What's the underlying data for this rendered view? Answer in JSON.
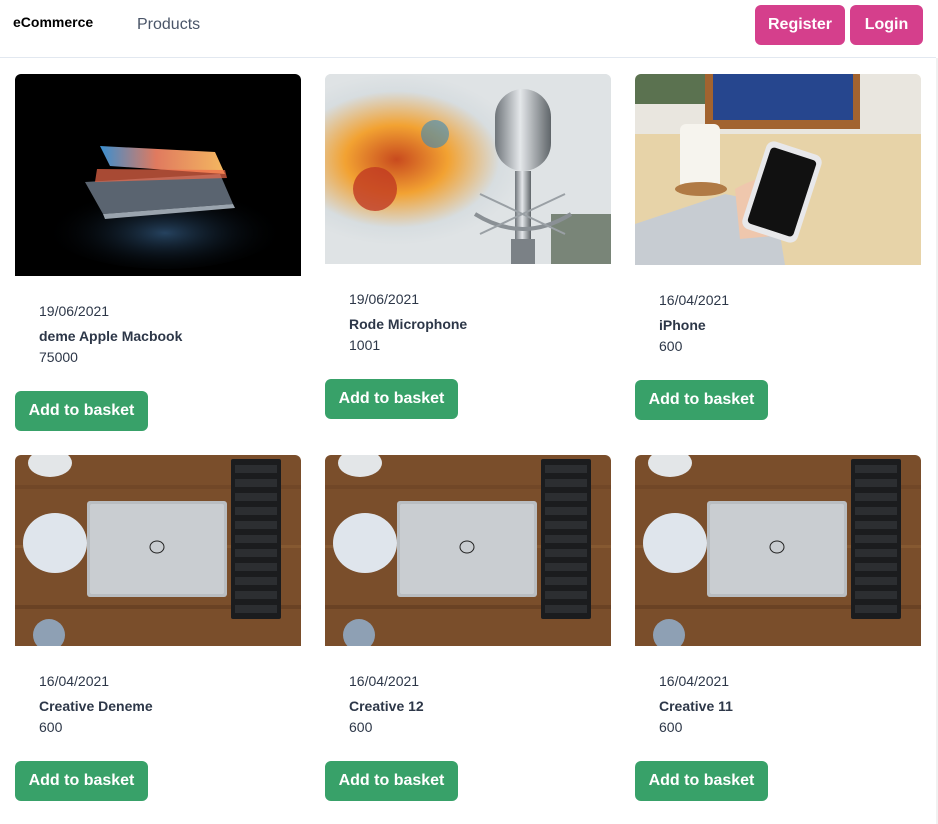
{
  "nav": {
    "brand": "eCommerce",
    "products_link": "Products",
    "register_label": "Register",
    "login_label": "Login"
  },
  "colors": {
    "register_button": "#d53f8c",
    "add_button": "#38a169"
  },
  "products": [
    {
      "date": "19/06/2021",
      "title": "deme Apple Macbook",
      "price": "75000",
      "button": "Add to basket",
      "image": "laptop-dark-photo"
    },
    {
      "date": "19/06/2021",
      "title": "Rode Microphone",
      "price": "1001",
      "button": "Add to basket",
      "image": "microphone-photo"
    },
    {
      "date": "16/04/2021",
      "title": "iPhone",
      "price": "600",
      "button": "Add to basket",
      "image": "phone-in-hand-photo"
    },
    {
      "date": "16/04/2021",
      "title": "Creative Deneme",
      "price": "600",
      "button": "Add to basket",
      "image": "laptop-on-desk-photo"
    },
    {
      "date": "16/04/2021",
      "title": "Creative 12",
      "price": "600",
      "button": "Add to basket",
      "image": "laptop-on-desk-photo"
    },
    {
      "date": "16/04/2021",
      "title": "Creative 11",
      "price": "600",
      "button": "Add to basket",
      "image": "laptop-on-desk-photo"
    }
  ]
}
